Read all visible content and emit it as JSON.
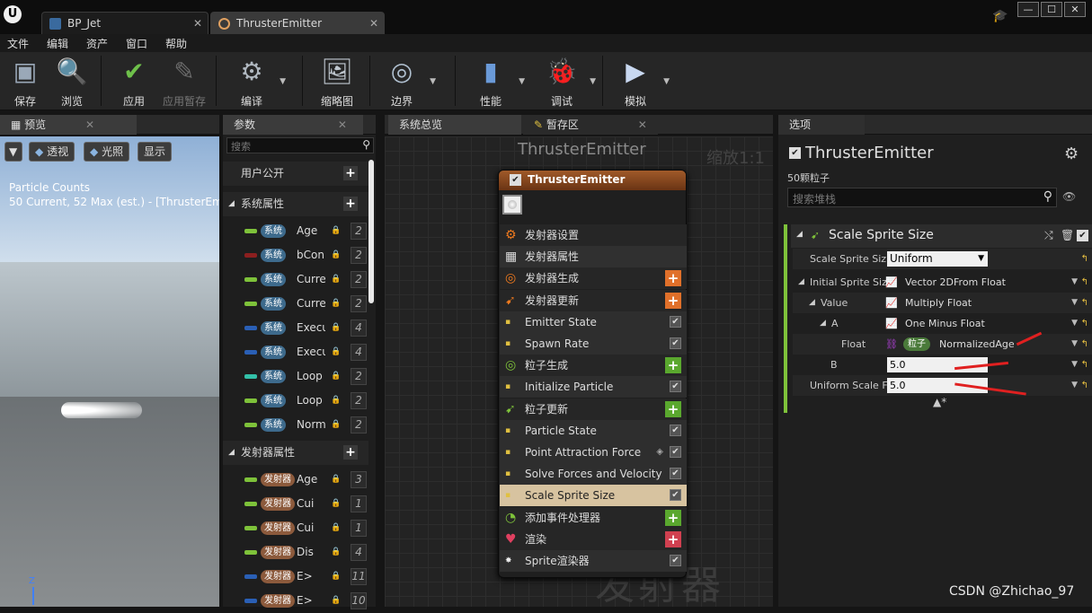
{
  "tabs": [
    {
      "label": "BP_Jet",
      "active": false
    },
    {
      "label": "ThrusterEmitter",
      "active": true
    }
  ],
  "menu": [
    "文件",
    "编辑",
    "资产",
    "窗口",
    "帮助"
  ],
  "toolbar": {
    "save": "保存",
    "browse": "浏览",
    "apply": "应用",
    "apply_pending": "应用暂存",
    "compile": "编译",
    "thumbnail": "缩略图",
    "bounds": "边界",
    "performance": "性能",
    "debug": "调试",
    "simulate": "模拟"
  },
  "preview": {
    "tab": "预览",
    "perspective": "透视",
    "lighting": "光照",
    "show": "显示",
    "overlay_title": "Particle Counts",
    "overlay_line": "50 Current, 52 Max (est.) - [ThrusterEmit",
    "axis_z": "Z"
  },
  "params": {
    "tab": "参数",
    "search_placeholder": "搜索",
    "user_exposed": "用户公开",
    "system_header": "系统属性",
    "system_pill": "系统",
    "system_items": [
      {
        "name": "Age",
        "color": "#7ec23a",
        "num": "2"
      },
      {
        "name": "bCon",
        "color": "#8c1f1f",
        "num": "2"
      },
      {
        "name": "Curre",
        "color": "#7ec23a",
        "num": "2"
      },
      {
        "name": "Curre",
        "color": "#7ec23a",
        "num": "2"
      },
      {
        "name": "Execu",
        "color": "#2a5fb5",
        "num": "4"
      },
      {
        "name": "Execu",
        "color": "#2a5fb5",
        "num": "4"
      },
      {
        "name": "Loop",
        "color": "#33c0a8",
        "num": "2"
      },
      {
        "name": "Loop",
        "color": "#7ec23a",
        "num": "2"
      },
      {
        "name": "Norm",
        "color": "#7ec23a",
        "num": "2"
      }
    ],
    "emitter_header": "发射器属性",
    "emitter_pill": "发射器",
    "emitter_items": [
      {
        "name": "Age",
        "color": "#7ec23a",
        "num": "3"
      },
      {
        "name": "Cui",
        "color": "#7ec23a",
        "num": "1"
      },
      {
        "name": "Cui",
        "color": "#7ec23a",
        "num": "1"
      },
      {
        "name": "Dis",
        "color": "#7ec23a",
        "num": "4"
      },
      {
        "name": "E>",
        "color": "#2a5fb5",
        "num": "11"
      },
      {
        "name": "E>",
        "color": "#2a5fb5",
        "num": "10"
      }
    ]
  },
  "graph": {
    "tab": "系统总览",
    "tab2": "暂存区",
    "title": "ThrusterEmitter",
    "zoom": "缩放1:1",
    "watermark": "发射器",
    "node_title": "ThrusterEmitter",
    "rows": [
      {
        "label": "发射器设置",
        "icon": "emitter-settings-icon",
        "kind": "section"
      },
      {
        "label": "发射器属性",
        "icon": "cpu-icon",
        "kind": "section"
      },
      {
        "label": "发射器生成",
        "icon": "emitter-spawn-icon",
        "kind": "add-orange"
      },
      {
        "label": "发射器更新",
        "icon": "emitter-update-icon",
        "kind": "add-orange"
      },
      {
        "label": "Emitter State",
        "icon": "module-icon",
        "kind": "check"
      },
      {
        "label": "Spawn Rate",
        "icon": "module-icon",
        "kind": "check"
      },
      {
        "label": "粒子生成",
        "icon": "particle-spawn-icon",
        "kind": "add-green"
      },
      {
        "label": "Initialize Particle",
        "icon": "module-icon",
        "kind": "check"
      },
      {
        "label": "粒子更新",
        "icon": "particle-update-icon",
        "kind": "add-green"
      },
      {
        "label": "Particle State",
        "icon": "module-icon",
        "kind": "check"
      },
      {
        "label": "Point Attraction Force",
        "icon": "module-icon",
        "kind": "check"
      },
      {
        "label": "Solve Forces and Velocity",
        "icon": "module-icon",
        "kind": "check"
      },
      {
        "label": "Scale Sprite Size",
        "icon": "module-icon",
        "kind": "selected"
      },
      {
        "label": "添加事件处理器",
        "icon": "event-handler-icon",
        "kind": "add-green"
      },
      {
        "label": "渲染",
        "icon": "render-icon",
        "kind": "add-red"
      },
      {
        "label": "Sprite渲染器",
        "icon": "sprite-renderer-icon",
        "kind": "check"
      }
    ]
  },
  "details": {
    "tab": "选项",
    "title": "ThrusterEmitter",
    "subtitle": "50颗粒子",
    "search_placeholder": "搜索堆栈",
    "module_title": "Scale Sprite Size",
    "rows": {
      "scale_label": "Scale Sprite Siz",
      "scale_value": "Uniform",
      "initial_label": "Initial Sprite Siz",
      "initial_value": "Vector 2DFrom Float",
      "value_label": "Value",
      "value_value": "Multiply Float",
      "a_label": "A",
      "a_value": "One Minus Float",
      "float_label": "Float",
      "float_pill": "粒子",
      "float_value": "NormalizedAge",
      "b_label": "B",
      "b_value": "5.0",
      "uniform_label": "Uniform Scale F",
      "uniform_value": "5.0"
    }
  },
  "watermark": "CSDN @Zhichao_97"
}
